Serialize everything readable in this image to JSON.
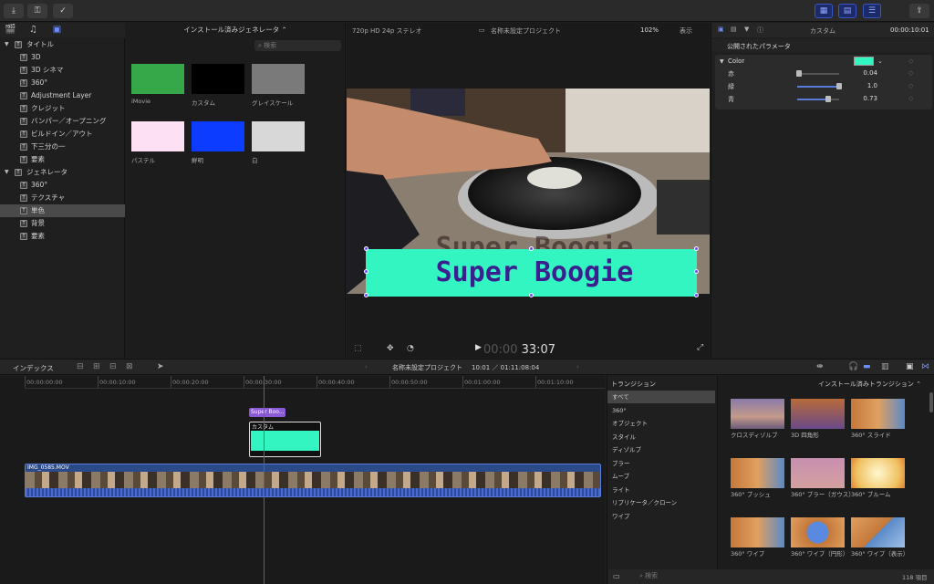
{
  "toolbar": {
    "left_buttons": [
      "download-icon",
      "key-icon",
      "check-icon"
    ],
    "right_buttons": [
      "browser-toggle-icon",
      "timeline-toggle-icon",
      "inspector-toggle-icon"
    ],
    "share": "share-icon"
  },
  "sidebar": {
    "items": [
      {
        "label": "タイトル",
        "level": 0,
        "expanded": true,
        "selected": false
      },
      {
        "label": "3D",
        "level": 1,
        "selected": false
      },
      {
        "label": "3D シネマ",
        "level": 1,
        "selected": false
      },
      {
        "label": "360°",
        "level": 1,
        "selected": false
      },
      {
        "label": "Adjustment Layer",
        "level": 1,
        "selected": false
      },
      {
        "label": "クレジット",
        "level": 1,
        "selected": false
      },
      {
        "label": "バンパー／オープニング",
        "level": 1,
        "selected": false
      },
      {
        "label": "ビルドイン／アウト",
        "level": 1,
        "selected": false
      },
      {
        "label": "下三分の一",
        "level": 1,
        "selected": false
      },
      {
        "label": "要素",
        "level": 1,
        "selected": false
      },
      {
        "label": "ジェネレータ",
        "level": 0,
        "expanded": true,
        "selected": false
      },
      {
        "label": "360°",
        "level": 1,
        "selected": false
      },
      {
        "label": "テクスチャ",
        "level": 1,
        "selected": false
      },
      {
        "label": "単色",
        "level": 1,
        "selected": true
      },
      {
        "label": "背景",
        "level": 1,
        "selected": false
      },
      {
        "label": "要素",
        "level": 1,
        "selected": false
      }
    ]
  },
  "browser": {
    "title": "インストール済みジェネレータ ⌃",
    "search_placeholder": "検索",
    "swatches": [
      {
        "label": "iMovie",
        "color": "#37a84a"
      },
      {
        "label": "カスタム",
        "color": "#000000"
      },
      {
        "label": "グレイスケール",
        "color": "#7a7a7a"
      },
      {
        "label": "パステル",
        "color": "#fde0f4"
      },
      {
        "label": "鮮明",
        "color": "#0b3cff"
      },
      {
        "label": "白",
        "color": "#d8d8d8"
      }
    ]
  },
  "viewer": {
    "format": "720p HD 24p ステレオ",
    "project": "名称未設定プロジェクト",
    "zoom": "102%",
    "display": "表示",
    "title_text": "Super Boogie",
    "timecode_dim": "00:00",
    "timecode": "33:07"
  },
  "inspector": {
    "header": "カスタム",
    "time": "00:00:10:01",
    "section": "公開されたパラメータ",
    "color_label": "Color",
    "color_value": "#33f5c2",
    "params": [
      {
        "label": "赤",
        "value": "0.04",
        "fraction": 0.04
      },
      {
        "label": "緑",
        "value": "1.0",
        "fraction": 1.0
      },
      {
        "label": "青",
        "value": "0.73",
        "fraction": 0.73
      }
    ]
  },
  "timeline_bar": {
    "index_label": "インデックス",
    "project": "名称未設定プロジェクト",
    "duration": "10:01 ／ 01:11:08:04",
    "transitions_title": "インストール済みトランジション ⌃"
  },
  "timeline": {
    "ticks": [
      "00:00:00:00",
      "00:00:10:00",
      "00:00:20:00",
      "00:00:30:00",
      "00:00:40:00",
      "00:00:50:00",
      "00:01:00:00",
      "00:01:10:00"
    ],
    "title_clip": "Super Boo...",
    "generator_clip": "カスタム",
    "video_clip": "IMG_0585.MOV"
  },
  "transitions": {
    "header": "トランジション",
    "categories": [
      "すべて",
      "360°",
      "オブジェクト",
      "スタイル",
      "ディゾルブ",
      "ブラー",
      "ムーブ",
      "ライト",
      "リプリケータ／クローン",
      "ワイプ"
    ],
    "selected": "すべて",
    "items": [
      "クロスディゾルブ",
      "3D 四角形",
      "360° スライド",
      "360° ブッシュ",
      "360° ブラー（ガウス）",
      "360° ブルーム",
      "360° ワイプ",
      "360° ワイプ（円形）",
      "360° ワイプ（表示）"
    ],
    "search_placeholder": "検索",
    "count": "118 項目"
  }
}
